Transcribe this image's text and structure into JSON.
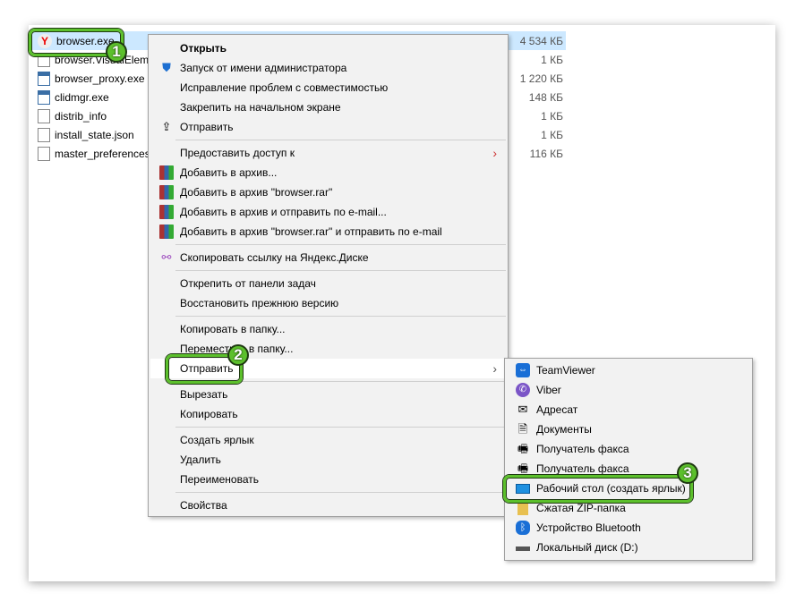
{
  "files": [
    {
      "name": "browser.exe",
      "size": "4 534 КБ",
      "icon": "yandex-icon"
    },
    {
      "name": "browser.VisualElements",
      "size": "1 КБ",
      "icon": "file-icon"
    },
    {
      "name": "browser_proxy.exe",
      "size": "1 220 КБ",
      "icon": "exe-icon"
    },
    {
      "name": "clidmgr.exe",
      "size": "148 КБ",
      "icon": "exe-icon"
    },
    {
      "name": "distrib_info",
      "size": "1 КБ",
      "icon": "file-icon"
    },
    {
      "name": "install_state.json",
      "size": "1 КБ",
      "icon": "file-icon"
    },
    {
      "name": "master_preferences",
      "size": "116 КБ",
      "icon": "file-icon"
    }
  ],
  "context_menu": {
    "open": "Открыть",
    "run_admin": "Запуск от имени администратора",
    "compat": "Исправление проблем с совместимостью",
    "pin_start": "Закрепить на начальном экране",
    "share": "Отправить",
    "give_access": "Предоставить доступ к",
    "add_archive": "Добавить в архив...",
    "add_rar": "Добавить в архив \"browser.rar\"",
    "add_email": "Добавить в архив и отправить по e-mail...",
    "add_rar_email": "Добавить в архив \"browser.rar\" и отправить по e-mail",
    "yadisk": "Скопировать ссылку на Яндекс.Диске",
    "unpin_taskbar": "Открепить от панели задач",
    "restore": "Восстановить прежнюю версию",
    "copy_to": "Копировать в папку...",
    "move_to": "Переместить в папку...",
    "send_to": "Отправить",
    "cut": "Вырезать",
    "copy": "Копировать",
    "shortcut": "Создать ярлык",
    "delete": "Удалить",
    "rename": "Переименовать",
    "properties": "Свойства"
  },
  "send_to_menu": [
    "TeamViewer",
    "Viber",
    "Адресат",
    "Документы",
    "Получатель факса",
    "Получатель факса",
    "Рабочий стол (создать ярлык)",
    "Сжатая ZIP-папка",
    "Устройство Bluetooth",
    "Локальный диск (D:)"
  ],
  "annotations": [
    "1",
    "2",
    "3"
  ],
  "colors": {
    "accent": "#5cc02c",
    "selection": "#cce8ff"
  }
}
